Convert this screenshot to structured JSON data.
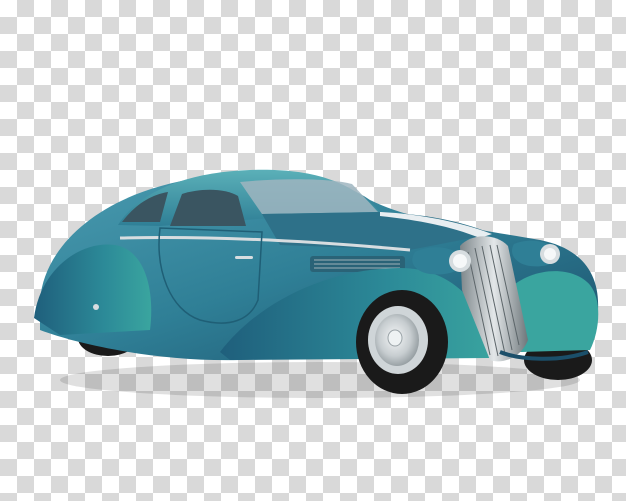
{
  "image": {
    "subject": "",
    "background": "transparency-checkerboard",
    "colors": {
      "body_main": "#2f7f96",
      "body_dark": "#1b4f6a",
      "body_light": "#5bb0b8",
      "chrome": "#d7dde0",
      "tire": "#1a1a1a",
      "checker_light": "#ffffff",
      "checker_dark": "#d9d9d9"
    }
  }
}
